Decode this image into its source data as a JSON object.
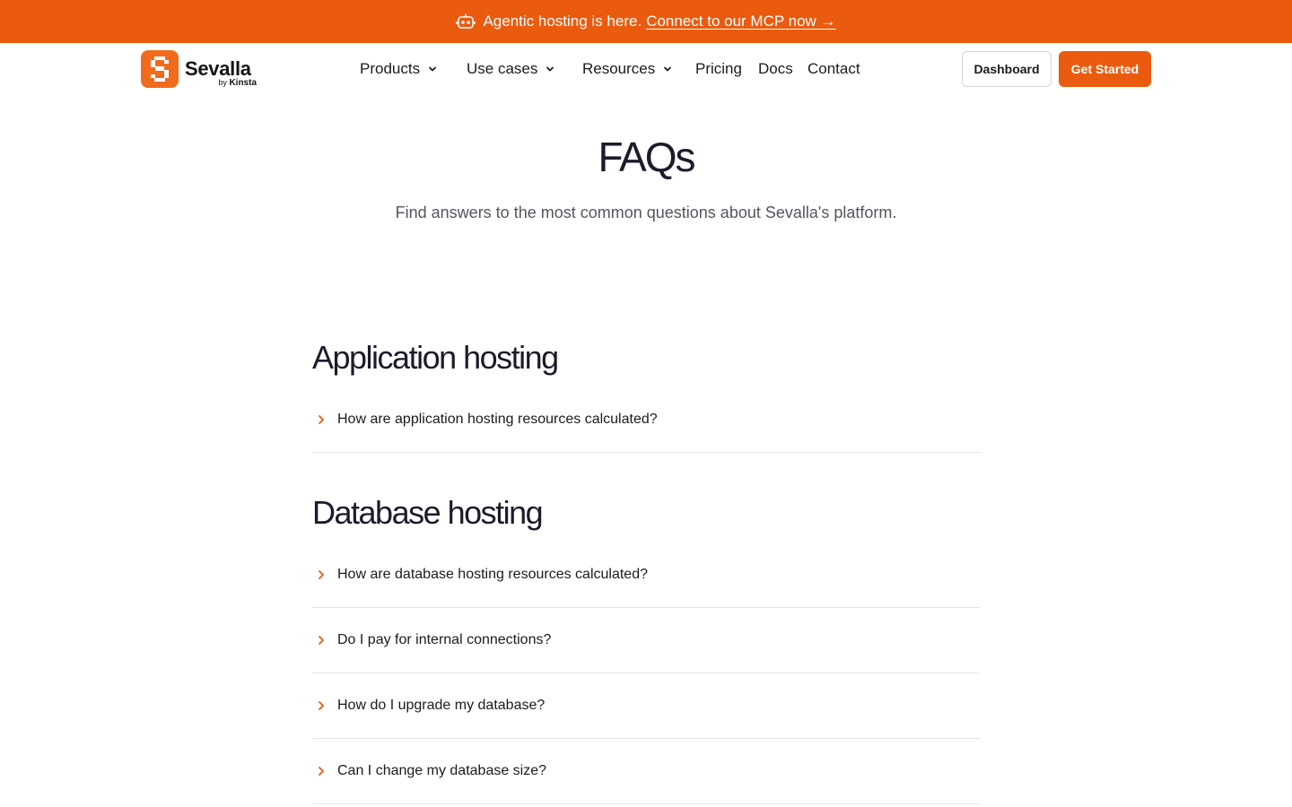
{
  "announcement": {
    "icon": "robot-icon",
    "text": "Agentic hosting is here.",
    "link": "Connect to our MCP now →",
    "bg_color": "#ea5b0f"
  },
  "nav": {
    "logo_name": "Sevalla",
    "logo_by": "by",
    "logo_brand": "Kinsta",
    "menu": {
      "products": "Products",
      "use_cases": "Use cases",
      "resources": "Resources",
      "pricing": "Pricing",
      "docs": "Docs",
      "contact": "Contact"
    },
    "dashboard_label": "Dashboard",
    "get_started_label": "Get Started",
    "accent_color": "#ea5b0f"
  },
  "hero": {
    "title": "FAQs",
    "subtitle": "Find answers to the most common questions about Sevalla's platform."
  },
  "sections": [
    {
      "title": "Application hosting",
      "questions": [
        "How are application hosting resources calculated?"
      ]
    },
    {
      "title": "Database hosting",
      "questions": [
        "How are database hosting resources calculated?",
        "Do I pay for internal connections?",
        "How do I upgrade my database?",
        "Can I change my database size?"
      ]
    }
  ]
}
